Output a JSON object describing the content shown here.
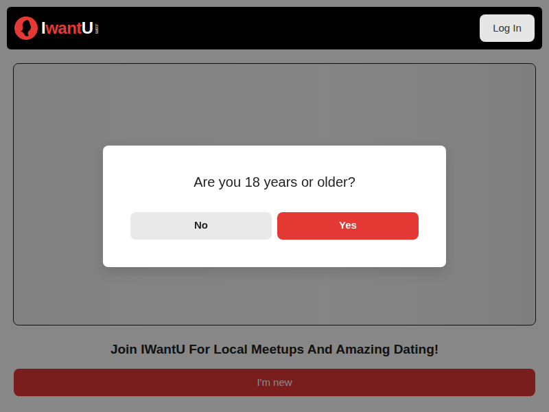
{
  "header": {
    "logo": {
      "parts": [
        "I",
        "want",
        "U"
      ],
      "suffix": ".com"
    },
    "login_button": "Log In"
  },
  "tagline": "Join IWantU For Local Meetups And Amazing Dating!",
  "signup_button": "I'm new",
  "age_dialog": {
    "question": "Are you 18 years or older?",
    "buttons": [
      {
        "label": "No",
        "kind": "secondary"
      },
      {
        "label": "Yes",
        "kind": "primary"
      }
    ]
  }
}
